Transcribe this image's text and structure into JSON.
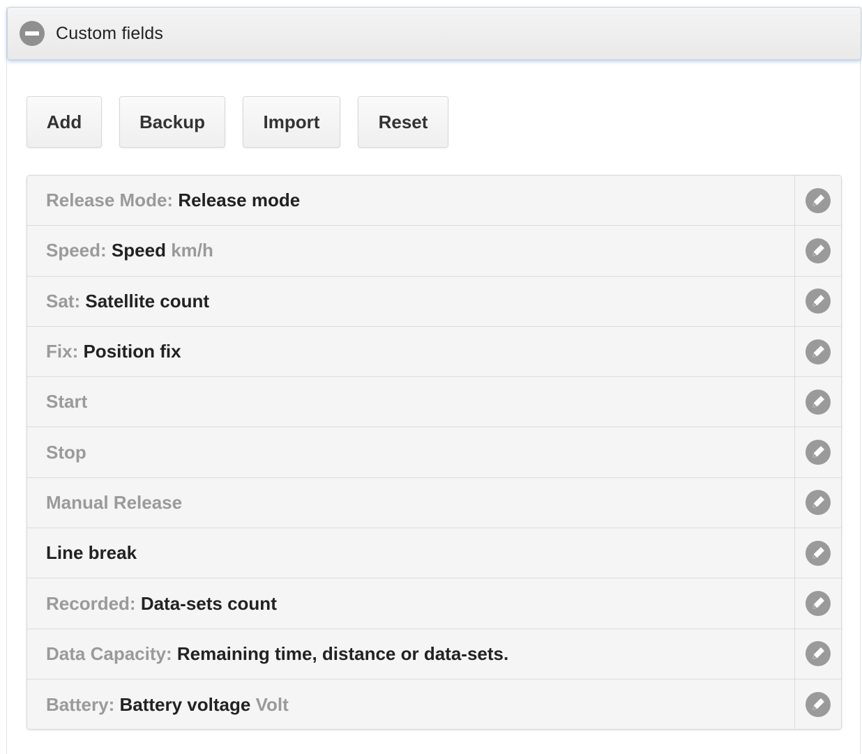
{
  "panel": {
    "title": "Custom fields",
    "collapse_icon": "minus-circle-icon"
  },
  "toolbar": {
    "add_label": "Add",
    "backup_label": "Backup",
    "import_label": "Import",
    "reset_label": "Reset"
  },
  "fields": [
    {
      "label": "Release Mode:",
      "value": "Release mode",
      "unit": ""
    },
    {
      "label": "Speed:",
      "value": "Speed",
      "unit": "km/h"
    },
    {
      "label": "Sat:",
      "value": "Satellite count",
      "unit": ""
    },
    {
      "label": "Fix:",
      "value": "Position fix",
      "unit": ""
    },
    {
      "label": "Start",
      "value": "",
      "unit": ""
    },
    {
      "label": "Stop",
      "value": "",
      "unit": ""
    },
    {
      "label": "Manual Release",
      "value": "",
      "unit": ""
    },
    {
      "label": "",
      "value": "Line break",
      "unit": ""
    },
    {
      "label": "Recorded:",
      "value": "Data-sets count",
      "unit": ""
    },
    {
      "label": "Data Capacity:",
      "value": "Remaining time, distance or data-sets.",
      "unit": ""
    },
    {
      "label": "Battery:",
      "value": "Battery voltage",
      "unit": "Volt"
    }
  ],
  "row_action_icon": "pencil-edit-icon"
}
